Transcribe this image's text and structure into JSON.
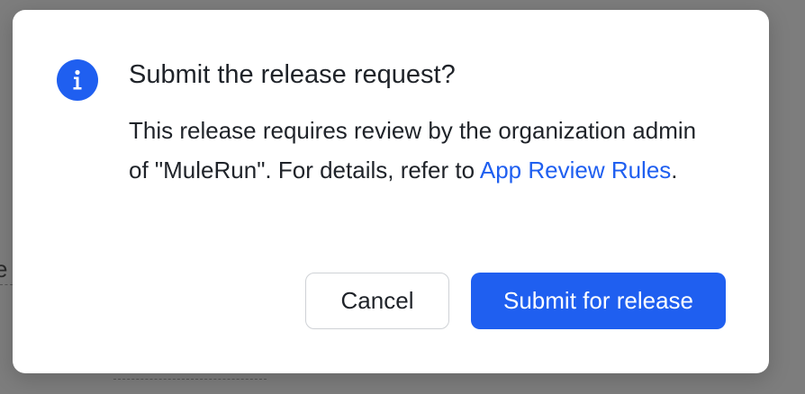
{
  "background": {
    "edge_text": "e"
  },
  "dialog": {
    "icon": "info-icon",
    "title": "Submit the release request?",
    "message_before_link": "This release requires review by the organization admin of \"MuleRun\". For details, refer to ",
    "link_text": "App Review Rules",
    "message_after_link": ".",
    "cancel_label": "Cancel",
    "submit_label": "Submit for release"
  },
  "colors": {
    "accent": "#1f5ff0",
    "text": "#1f2329",
    "overlay": "#7d7d7d",
    "surface": "#ffffff"
  }
}
